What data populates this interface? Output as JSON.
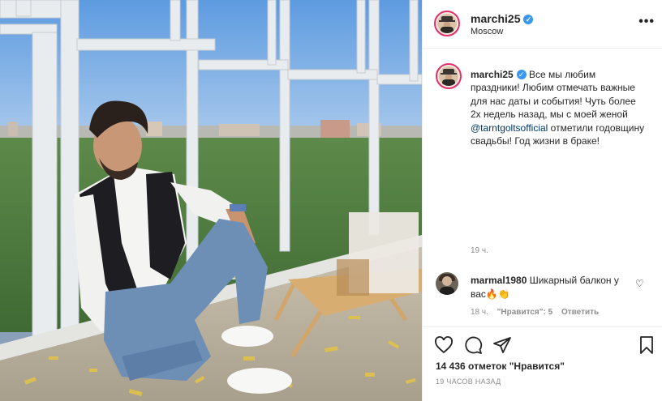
{
  "post": {
    "username": "marchi25",
    "location": "Moscow",
    "more_label": "•••"
  },
  "caption": {
    "username": "marchi25",
    "text_before_mention": "Все мы любим праздники! Любим отмечать важные для нас даты и события! Чуть более 2х недель назад, мы с моей женой ",
    "mention": "@tarntgoltsofficial",
    "text_after_mention": " отметили годовщину свадьбы! Год жизни в браке!",
    "time": "19 ч."
  },
  "comment": {
    "username": "marmal1980",
    "text": "Шикарный балкон у вас🔥👏",
    "time": "18 ч.",
    "likes_label": "\"Нравится\": 5",
    "reply_label": "Ответить",
    "like_icon": "♡"
  },
  "actions": {
    "likes_text": "14 436 отметок \"Нравится\"",
    "post_time": "19 ЧАСОВ НАЗАД"
  },
  "icons": [
    "heart-icon",
    "comment-icon",
    "share-icon",
    "bookmark-icon",
    "verified-icon",
    "more-options-icon"
  ],
  "colors": {
    "verified": "#3897f0",
    "story_ring": "#e1306c",
    "mention": "#00376b",
    "meta_gray": "#8e8e8e"
  }
}
